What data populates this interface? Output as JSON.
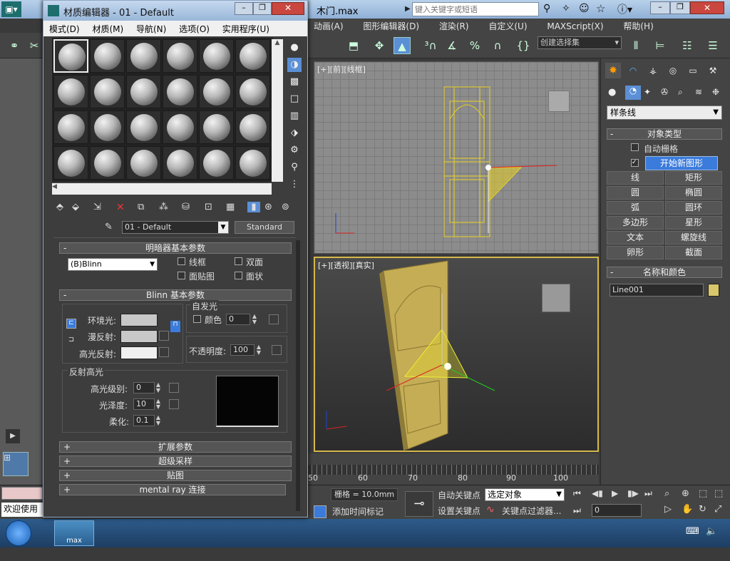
{
  "app": {
    "file_title": "木门.max",
    "search_placeholder": "键入关键字或短语",
    "menus": [
      "动画(A)",
      "图形编辑器(D)",
      "渲染(R)",
      "自定义(U)",
      "MAXScript(X)",
      "帮助(H)"
    ],
    "selection_set": "创建选择集"
  },
  "viewports": {
    "front_label": "[+][前][线框]",
    "persp_label": "[+][透视][真实]"
  },
  "material_editor": {
    "title": "材质编辑器 - 01 - Default",
    "menus": [
      "模式(D)",
      "材质(M)",
      "导航(N)",
      "选项(O)",
      "实用程序(U)"
    ],
    "material_name": "01 - Default",
    "material_type": "Standard",
    "shader_rollout": "明暗器基本参数",
    "shader": "(B)Blinn",
    "wire": "线框",
    "two_sided": "双面",
    "face_map": "面贴图",
    "faceted": "面状",
    "blinn_rollout": "Blinn 基本参数",
    "self_illum": "自发光",
    "color": "颜色",
    "self_illum_value": "0",
    "ambient": "环境光:",
    "diffuse": "漫反射:",
    "specular": "高光反射:",
    "opacity_label": "不透明度:",
    "opacity_value": "100",
    "spec_highlights": "反射高光",
    "spec_level": "高光级别:",
    "spec_level_value": "0",
    "glossiness": "光泽度:",
    "glossiness_value": "10",
    "soften": "柔化:",
    "soften_value": "0.1",
    "rollouts": [
      "扩展参数",
      "超级采样",
      "贴图",
      "mental ray 连接"
    ],
    "rollout_signs": {
      "minus": "-",
      "plus": "+"
    }
  },
  "command_panel": {
    "category": "样条线",
    "object_type": "对象类型",
    "auto_grid": "自动栅格",
    "start_new_shape": "开始新图形",
    "buttons": [
      "线",
      "矩形",
      "圆",
      "椭圆",
      "弧",
      "圆环",
      "多边形",
      "星形",
      "文本",
      "螺旋线",
      "卵形",
      "截面"
    ],
    "name_color": "名称和颜色",
    "object_name": "Line001"
  },
  "timeline": {
    "ticks": [
      "50",
      "60",
      "70",
      "80",
      "90",
      "100"
    ]
  },
  "status": {
    "welcome": "欢迎使用",
    "grid": "栅格 = 10.0mm",
    "auto_key": "自动关键点",
    "set_key": "设置关键点",
    "selected": "选定对象",
    "key_filters": "关键点过滤器...",
    "add_time_tag": "添加时间标记",
    "frame": "0"
  },
  "taskbar": {
    "app_badge": "max"
  },
  "colors": {
    "accent_blue": "#3b7bdc",
    "selection_yellow": "#d6b84a",
    "object_color": "#d8c86a"
  }
}
